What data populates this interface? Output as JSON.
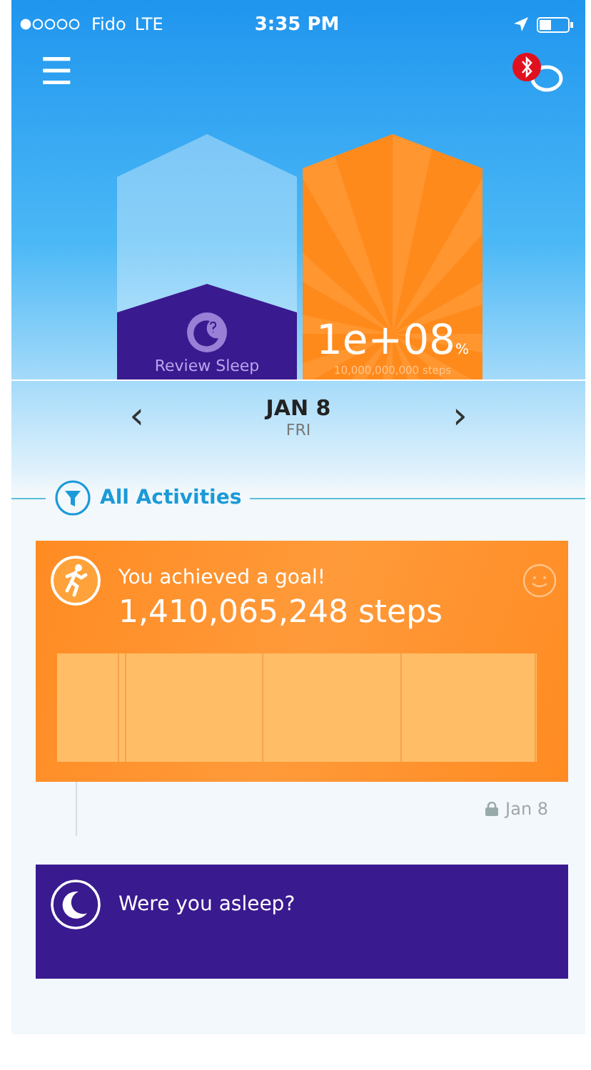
{
  "status_bar": {
    "carrier": "Fido",
    "network": "LTE",
    "time": "3:35 PM"
  },
  "header": {
    "menu_icon": "☰",
    "sync_error": true
  },
  "towers": {
    "sleep_label": "Review Sleep",
    "steps_value": "1e+08",
    "steps_unit": "%",
    "steps_goal": "10,000,000,000 steps"
  },
  "date_nav": {
    "prev": "‹",
    "date": "JAN 8",
    "weekday": "FRI",
    "next": "›"
  },
  "filter": {
    "label": "All Activities"
  },
  "cards": [
    {
      "kind": "steps",
      "title": "You achieved a goal!",
      "value": "1,410,065,248 steps",
      "footer": "Jan 8"
    },
    {
      "kind": "sleep",
      "title": "Were you asleep?"
    }
  ]
}
